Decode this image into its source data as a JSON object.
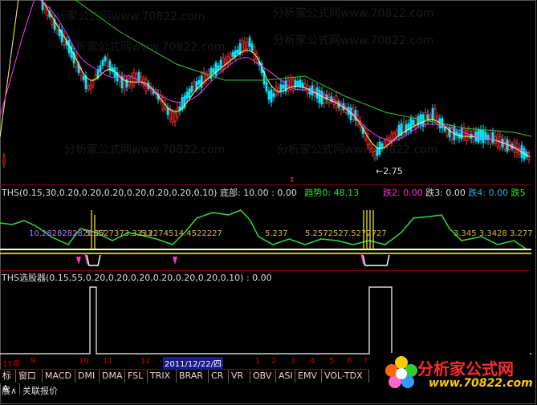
{
  "price_panel": {
    "low_marker": "2.75",
    "watermarks": [
      "分析家公式网www.70822.com",
      "分析家公式网www.70822.com",
      "分析家公式网www.70822.com",
      "分析家公式网www.70822.com",
      "分析家公式网www.70822.com",
      "分析家公式网www.70822.com"
    ]
  },
  "ths_panel": {
    "params": "THS(0.15,30,0.20,0.20,0.20,0.20,0.20,0.20,0.10)",
    "bottom_label": "底部:",
    "bottom_value": "10.00",
    "colon1": ": 0.00",
    "trend_label": "趋势0:",
    "trend_value": "48.13",
    "fall2": "跌2: 0.00",
    "fall3": "跌3: 0.00",
    "fall4": "跌4: 0.00",
    "fall5": "跌5",
    "values_left": "10.2828282828.27",
    "values_mid1": "5.3527373.3333",
    "values_mid2": "5.2274514.4522227",
    "values_mid3": "5.237",
    "values_mid4": "5.2572527.5272727",
    "values_right": "3.345  3.3428  3.277"
  },
  "selector_panel": {
    "params": "THS选股器(0.15,55,0.20,0.20,0.20,0.20,0.20,0.20,0.10)",
    "value": ": 0.00"
  },
  "time_axis": {
    "labels": [
      "11年",
      "9",
      "10",
      "11",
      "12",
      "1",
      "2",
      "3",
      "4",
      "5",
      "6",
      "7"
    ],
    "cursor_date": "2011/12/22/四"
  },
  "tabs": [
    "标A",
    "窗口",
    "MACD",
    "DMI",
    "DMA",
    "FSL",
    "TRIX",
    "BRAR",
    "CR",
    "VR",
    "OBV",
    "ASI",
    "EMV",
    "VOL-TDX"
  ],
  "bottom_bar": {
    "left": "展∧",
    "right": "关联报价"
  },
  "logo": {
    "title": "分析家公式网",
    "url": "www.70822.com"
  },
  "colors": {
    "up": "#ff3333",
    "down": "#00e5ff",
    "ma_yellow": "#ffff66",
    "ma_magenta": "#ff33ff",
    "ma_green": "#33cc33",
    "ths_green": "#33dd33",
    "signal_pink": "#ff33cc"
  }
}
